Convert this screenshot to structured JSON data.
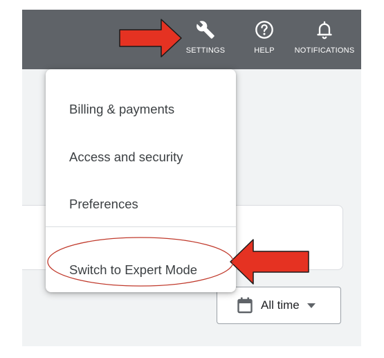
{
  "topbar": {
    "settings_label": "SETTINGS",
    "help_label": "HELP",
    "notifications_label": "NOTIFICATIONS"
  },
  "settings_menu": {
    "items": [
      {
        "label": "Billing & payments"
      },
      {
        "label": "Access and security"
      },
      {
        "label": "Preferences"
      },
      {
        "label": "Switch to Expert Mode"
      }
    ]
  },
  "date_range": {
    "label": "All time",
    "icon": "calendar-icon"
  },
  "annotations": {
    "arrow_color": "#e53222",
    "ellipse_color": "#c0392b"
  },
  "colors": {
    "topbar_bg": "#5f6368",
    "page_bg": "#f1f3f4"
  }
}
